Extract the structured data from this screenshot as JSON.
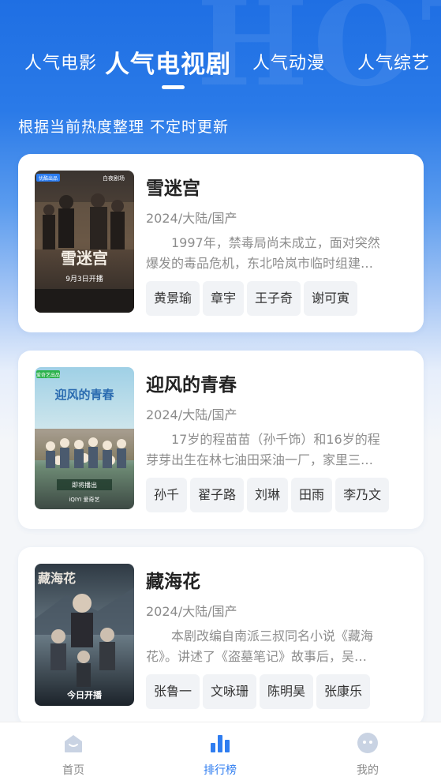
{
  "header": {
    "tabs": [
      {
        "label": "人气电影",
        "active": false
      },
      {
        "label": "人气电视剧",
        "active": true
      },
      {
        "label": "人气动漫",
        "active": false
      },
      {
        "label": "人气综艺",
        "active": false
      }
    ],
    "subtitle": "根据当前热度整理 不定时更新",
    "background_art_text": "HOT"
  },
  "cards": [
    {
      "title": "雪迷宫",
      "meta": "2024/大陆/国产",
      "desc_line1": "1997年，禁毒局尚未成立，面对突然",
      "desc_line2": "爆发的毒品危机，东北哈岚市临时组建…",
      "cast": [
        "黄景瑜",
        "章宇",
        "王子奇",
        "谢可寅"
      ],
      "poster": {
        "badge": "优酷出品",
        "brand": "白夜剧场",
        "title_art": "雪迷宫",
        "date": "9月3日开播"
      }
    },
    {
      "title": "迎风的青春",
      "meta": "2024/大陆/国产",
      "desc_line1": "17岁的程苗苗（孙千饰）和16岁的程",
      "desc_line2": "芽芽出生在林七油田采油一厂，家里三…",
      "cast": [
        "孙千",
        "翟子路",
        "刘琳",
        "田雨",
        "李乃文"
      ],
      "poster": {
        "badge": "爱奇艺出品",
        "title_art": "迎风的青春",
        "date": "即将播出",
        "platform": "iQIYI 爱奇艺"
      }
    },
    {
      "title": "藏海花",
      "meta": "2024/大陆/国产",
      "desc_line1": "本剧改编自南派三叔同名小说《藏海",
      "desc_line2": "花》。讲述了《盗墓笔记》故事后，吴…",
      "cast": [
        "张鲁一",
        "文咏珊",
        "陈明昊",
        "张康乐"
      ],
      "poster": {
        "title_art": "藏海花",
        "date": "今日开播"
      }
    }
  ],
  "bottom_nav": [
    {
      "label": "首页",
      "icon": "home-icon",
      "active": false
    },
    {
      "label": "排行榜",
      "icon": "ranking-icon",
      "active": true
    },
    {
      "label": "我的",
      "icon": "profile-icon",
      "active": false
    }
  ],
  "colors": {
    "accent": "#2f7df0",
    "hero_blue": "#1f6fe3",
    "chip_bg": "#f1f3f6",
    "text_gray": "#8a8a8a"
  }
}
